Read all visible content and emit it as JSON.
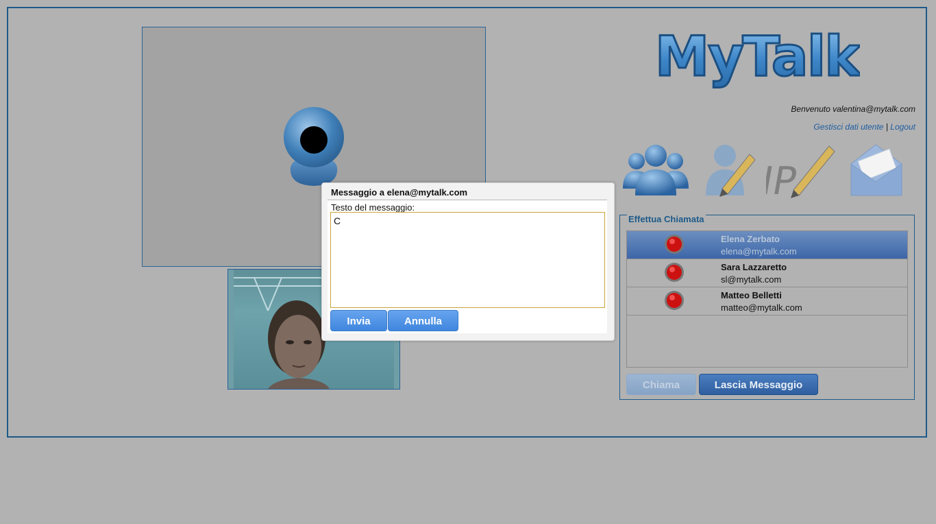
{
  "header": {
    "logo_text": "MyTalk",
    "welcome": "Benvenuto valentina@mytalk.com",
    "manage_link": "Gestisci dati utente",
    "separator": "|",
    "logout_link": "Logout"
  },
  "toolbar": {
    "icons": [
      "contacts-icon",
      "edit-contact-icon",
      "ip-edit-icon",
      "message-icon"
    ]
  },
  "call_panel": {
    "legend": "Effettua Chiamata",
    "contacts": [
      {
        "name": "Elena Zerbato",
        "email": "elena@mytalk.com",
        "selected": true
      },
      {
        "name": "Sara Lazzaretto",
        "email": "sl@mytalk.com",
        "selected": false
      },
      {
        "name": "Matteo Belletti",
        "email": "matteo@mytalk.com",
        "selected": false
      }
    ],
    "call_button": "Chiama",
    "leave_message_button": "Lascia Messaggio"
  },
  "dialog": {
    "title": "Messaggio a elena@mytalk.com",
    "label": "Testo del messaggio:",
    "message_value": "C",
    "send_button": "Invia",
    "cancel_button": "Annulla"
  },
  "colors": {
    "page_bg": "#b2b2b2",
    "frame_border": "#1d5a8a",
    "selected_row": "#3c66a8",
    "button_blue": "#4a8ce2"
  }
}
